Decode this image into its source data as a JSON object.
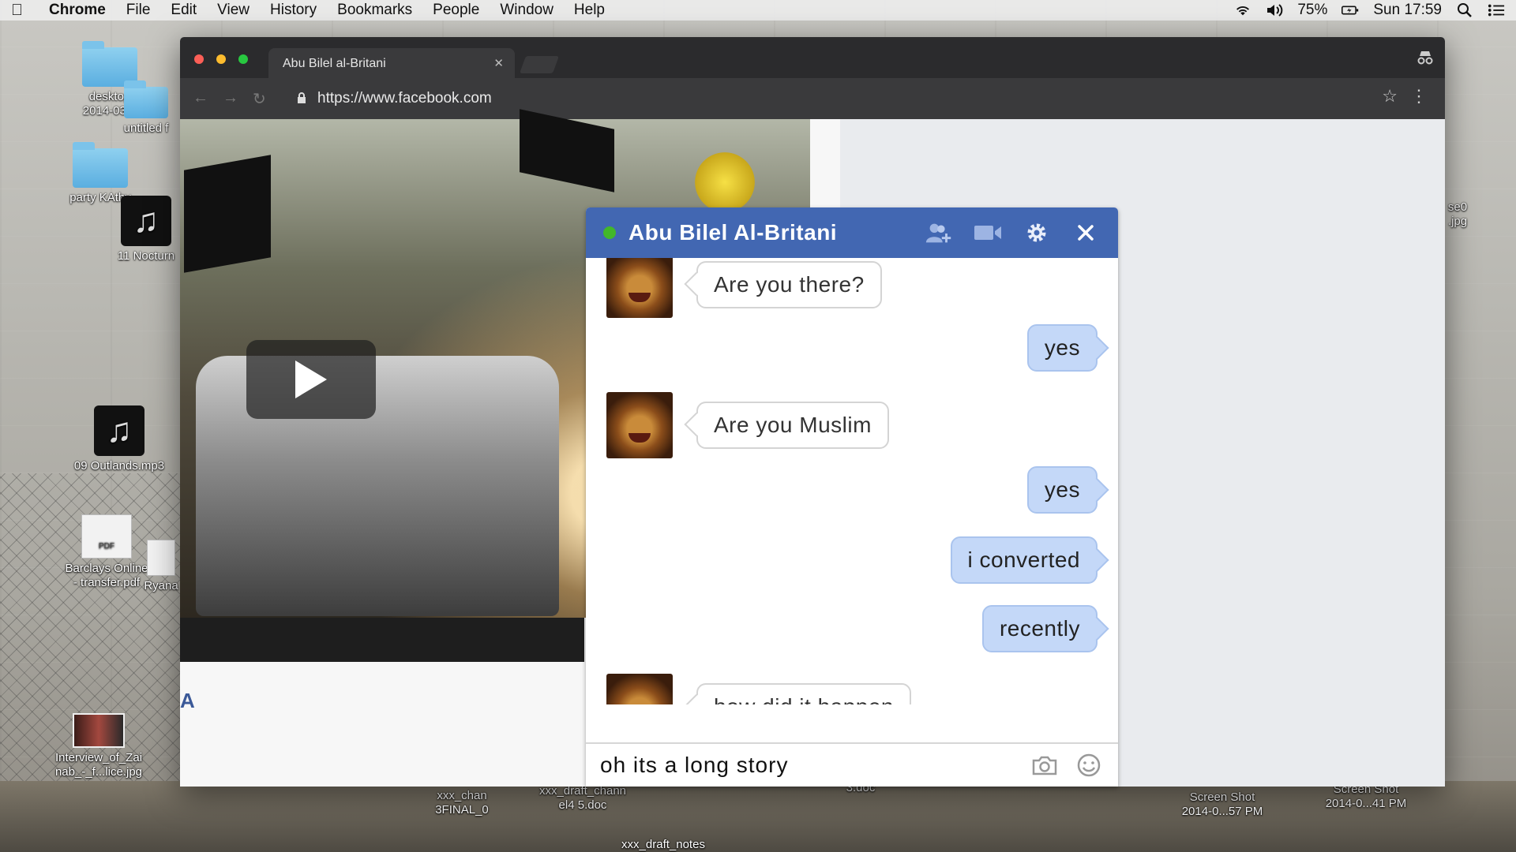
{
  "menubar": {
    "app": "Chrome",
    "items": [
      "File",
      "Edit",
      "View",
      "History",
      "Bookmarks",
      "People",
      "Window",
      "Help"
    ],
    "battery": "75%",
    "clock": "Sun 17:59"
  },
  "desktop": {
    "icons": [
      {
        "label": "desktop\n2014-03-2",
        "type": "folder"
      },
      {
        "label": "untitled f",
        "type": "folder"
      },
      {
        "label": "party KAthy",
        "type": "folder"
      },
      {
        "label": "11 Nocturn",
        "type": "music"
      },
      {
        "label": "09 Outlands.mp3",
        "type": "music"
      },
      {
        "label": "Barclays Online\n- transfer.pdf",
        "type": "pdf"
      },
      {
        "label": "Ryana",
        "type": "doc"
      },
      {
        "label": "Interview_of_Zai\nnab_-_f...lice.jpg",
        "type": "photo"
      },
      {
        "label": "xxx_chan\n3FINAL_0",
        "type": "doc"
      },
      {
        "label": "xxx_draft_chann\nel4 5.doc",
        "type": "doc"
      },
      {
        "label": "xxx_draft_notes",
        "type": "doc"
      },
      {
        "label": "3.doc",
        "type": "doc"
      },
      {
        "label": "Screen Shot\n2014-0...57 PM",
        "type": "image"
      },
      {
        "label": "Screen Shot\n2014-0...41 PM",
        "type": "image"
      },
      {
        "label": "se0\n.jpg",
        "type": "image"
      }
    ]
  },
  "browser": {
    "tab_title": "Abu Bilel al-Britani",
    "url": "https://www.facebook.com"
  },
  "page": {
    "partial_link": "A"
  },
  "chat": {
    "title": "Abu Bilel Al-Britani",
    "status_color": "#42b72a",
    "header_color": "#4267b2",
    "messages": [
      {
        "from": "contact",
        "text": "Are you there?"
      },
      {
        "from": "me",
        "text": "yes"
      },
      {
        "from": "contact",
        "text": "Are you Muslim"
      },
      {
        "from": "me",
        "text": "yes"
      },
      {
        "from": "me",
        "text": "i converted"
      },
      {
        "from": "me",
        "text": "recently"
      },
      {
        "from": "contact",
        "text": "how did it happen"
      }
    ],
    "composer_value": "oh its a long story"
  }
}
